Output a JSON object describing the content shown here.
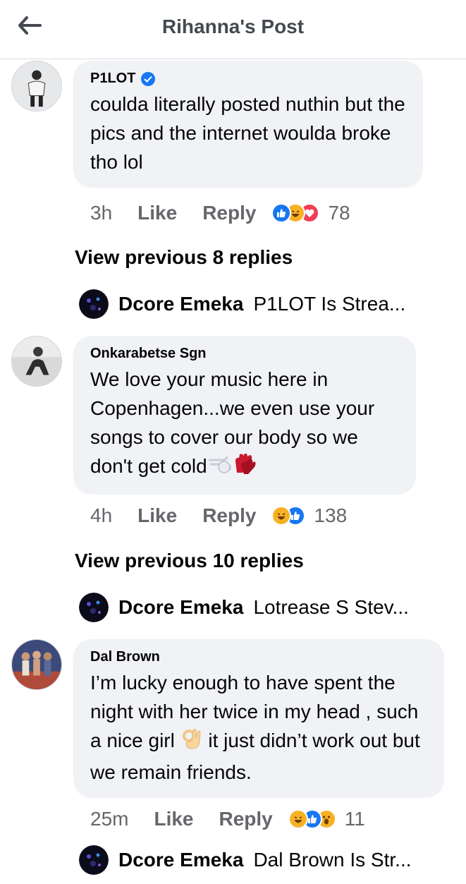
{
  "header": {
    "title": "Rihanna's Post"
  },
  "comments": [
    {
      "author": "P1LOT",
      "verified": true,
      "text": "coulda literally posted nuthin but the pics and the internet woulda broke tho lol",
      "time": "3h",
      "like": "Like",
      "reply": "Reply",
      "reactions": [
        "like-icon",
        "haha-icon",
        "love-icon"
      ],
      "reaction_count": "78"
    },
    {
      "author": "Onkarabetse Sgn",
      "verified": false,
      "text_lines": [
        "We love your music here in",
        "Copenhagen...we even use your",
        "songs to cover our body so we",
        "don't get cold"
      ],
      "emoji": [
        "dash-emoji",
        "gloves-emoji"
      ],
      "time": "4h",
      "like": "Like",
      "reply": "Reply",
      "reactions": [
        "haha-icon",
        "like-icon"
      ],
      "reaction_count": "138"
    },
    {
      "author": "Dal Brown",
      "verified": false,
      "text_a": "I’m lucky enough to have spent the night with her twice in my head , such a nice girl",
      "emoji": [
        "ok-hand-emoji"
      ],
      "text_b": "it just didn’t work out but we remain friends.",
      "time": "25m",
      "like": "Like",
      "reply": "Reply",
      "reactions": [
        "haha-icon",
        "like-icon",
        "wow-icon"
      ],
      "reaction_count": "11"
    }
  ],
  "view_previous": [
    "View previous 8 replies",
    "View previous 10 replies"
  ],
  "reply_previews": [
    {
      "name": "Dcore Emeka",
      "snippet": "P1LOT Is Strea..."
    },
    {
      "name": "Dcore Emeka",
      "snippet": "Lotrease S Stev..."
    },
    {
      "name": "Dcore Emeka",
      "snippet": "Dal Brown Is Str..."
    }
  ],
  "colors": {
    "bubble": "#f0f2f5",
    "meta_text": "#65676b",
    "like_blue": "#1877f2",
    "love_red": "#f33e58",
    "haha_yellow": "#f7b125"
  }
}
